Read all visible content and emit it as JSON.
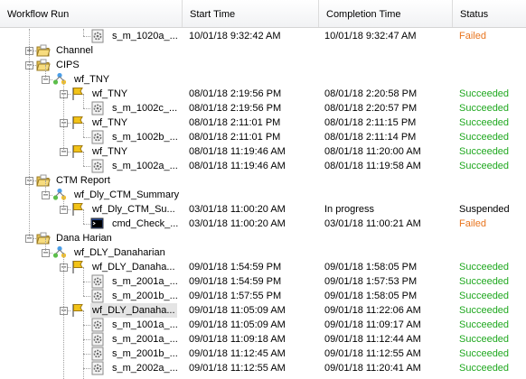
{
  "columns": [
    "Workflow Run",
    "Start Time",
    "Completion Time",
    "Status"
  ],
  "rows": [
    {
      "level": 4,
      "type": "session",
      "label": "s_m_1020a_...",
      "start": "10/01/18 9:32:42 AM",
      "end": "10/01/18 9:32:47 AM",
      "status": "Failed",
      "status_key": "failed",
      "toggle": ""
    },
    {
      "level": 1,
      "type": "folder",
      "label": "Channel",
      "start": "",
      "end": "",
      "status": "",
      "status_key": "",
      "toggle": "+"
    },
    {
      "level": 1,
      "type": "folder",
      "label": "CIPS",
      "start": "",
      "end": "",
      "status": "",
      "status_key": "",
      "toggle": "-"
    },
    {
      "level": 2,
      "type": "workflow",
      "label": "wf_TNY",
      "start": "",
      "end": "",
      "status": "",
      "status_key": "",
      "toggle": "-"
    },
    {
      "level": 3,
      "type": "run",
      "label": "wf_TNY",
      "start": "08/01/18 2:19:56 PM",
      "end": "08/01/18 2:20:58 PM",
      "status": "Succeeded",
      "status_key": "succeeded",
      "toggle": "-"
    },
    {
      "level": 4,
      "type": "session",
      "label": "s_m_1002c_...",
      "start": "08/01/18 2:19:56 PM",
      "end": "08/01/18 2:20:57 PM",
      "status": "Succeeded",
      "status_key": "succeeded",
      "toggle": ""
    },
    {
      "level": 3,
      "type": "run",
      "label": "wf_TNY",
      "start": "08/01/18 2:11:01 PM",
      "end": "08/01/18 2:11:15 PM",
      "status": "Succeeded",
      "status_key": "succeeded",
      "toggle": "-"
    },
    {
      "level": 4,
      "type": "session",
      "label": "s_m_1002b_...",
      "start": "08/01/18 2:11:01 PM",
      "end": "08/01/18 2:11:14 PM",
      "status": "Succeeded",
      "status_key": "succeeded",
      "toggle": ""
    },
    {
      "level": 3,
      "type": "run",
      "label": "wf_TNY",
      "start": "08/01/18 11:19:46 AM",
      "end": "08/01/18 11:20:00 AM",
      "status": "Succeeded",
      "status_key": "succeeded",
      "toggle": "-"
    },
    {
      "level": 4,
      "type": "session",
      "label": "s_m_1002a_...",
      "start": "08/01/18 11:19:46 AM",
      "end": "08/01/18 11:19:58 AM",
      "status": "Succeeded",
      "status_key": "succeeded",
      "toggle": ""
    },
    {
      "level": 1,
      "type": "folder",
      "label": "CTM Report",
      "start": "",
      "end": "",
      "status": "",
      "status_key": "",
      "toggle": "-"
    },
    {
      "level": 2,
      "type": "workflow",
      "label": "wf_Dly_CTM_Summary",
      "start": "",
      "end": "",
      "status": "",
      "status_key": "",
      "toggle": "-"
    },
    {
      "level": 3,
      "type": "run",
      "label": "wf_Dly_CTM_Su...",
      "start": "03/01/18 11:00:20 AM",
      "end": "In progress",
      "status": "Suspended",
      "status_key": "suspended",
      "toggle": "-"
    },
    {
      "level": 4,
      "type": "command",
      "label": "cmd_Check_...",
      "start": "03/01/18 11:00:20 AM",
      "end": "03/01/18 11:00:21 AM",
      "status": "Failed",
      "status_key": "failed",
      "toggle": ""
    },
    {
      "level": 1,
      "type": "folder",
      "label": "Dana Harian",
      "start": "",
      "end": "",
      "status": "",
      "status_key": "",
      "toggle": "-"
    },
    {
      "level": 2,
      "type": "workflow",
      "label": "wf_DLY_Danaharian",
      "start": "",
      "end": "",
      "status": "",
      "status_key": "",
      "toggle": "-"
    },
    {
      "level": 3,
      "type": "run",
      "label": "wf_DLY_Danaha...",
      "start": "09/01/18 1:54:59 PM",
      "end": "09/01/18 1:58:05 PM",
      "status": "Succeeded",
      "status_key": "succeeded",
      "toggle": "-"
    },
    {
      "level": 4,
      "type": "session",
      "label": "s_m_2001a_...",
      "start": "09/01/18 1:54:59 PM",
      "end": "09/01/18 1:57:53 PM",
      "status": "Succeeded",
      "status_key": "succeeded",
      "toggle": ""
    },
    {
      "level": 4,
      "type": "session",
      "label": "s_m_2001b_...",
      "start": "09/01/18 1:57:55 PM",
      "end": "09/01/18 1:58:05 PM",
      "status": "Succeeded",
      "status_key": "succeeded",
      "toggle": ""
    },
    {
      "level": 3,
      "type": "run",
      "label": "wf_DLY_Danaha...",
      "start": "09/01/18 11:05:09 AM",
      "end": "09/01/18 11:22:06 AM",
      "status": "Succeeded",
      "status_key": "succeeded",
      "toggle": "-",
      "selected": true
    },
    {
      "level": 4,
      "type": "session",
      "label": "s_m_1001a_...",
      "start": "09/01/18 11:05:09 AM",
      "end": "09/01/18 11:09:17 AM",
      "status": "Succeeded",
      "status_key": "succeeded",
      "toggle": ""
    },
    {
      "level": 4,
      "type": "session",
      "label": "s_m_2001a_...",
      "start": "09/01/18 11:09:18 AM",
      "end": "09/01/18 11:12:44 AM",
      "status": "Succeeded",
      "status_key": "succeeded",
      "toggle": ""
    },
    {
      "level": 4,
      "type": "session",
      "label": "s_m_2001b_...",
      "start": "09/01/18 11:12:45 AM",
      "end": "09/01/18 11:12:55 AM",
      "status": "Succeeded",
      "status_key": "succeeded",
      "toggle": ""
    },
    {
      "level": 4,
      "type": "session",
      "label": "s_m_2002a_...",
      "start": "09/01/18 11:12:55 AM",
      "end": "09/01/18 11:20:41 AM",
      "status": "Succeeded",
      "status_key": "succeeded",
      "toggle": ""
    }
  ],
  "colors": {
    "succeeded": "#1fa81f",
    "failed": "#e8751f"
  }
}
